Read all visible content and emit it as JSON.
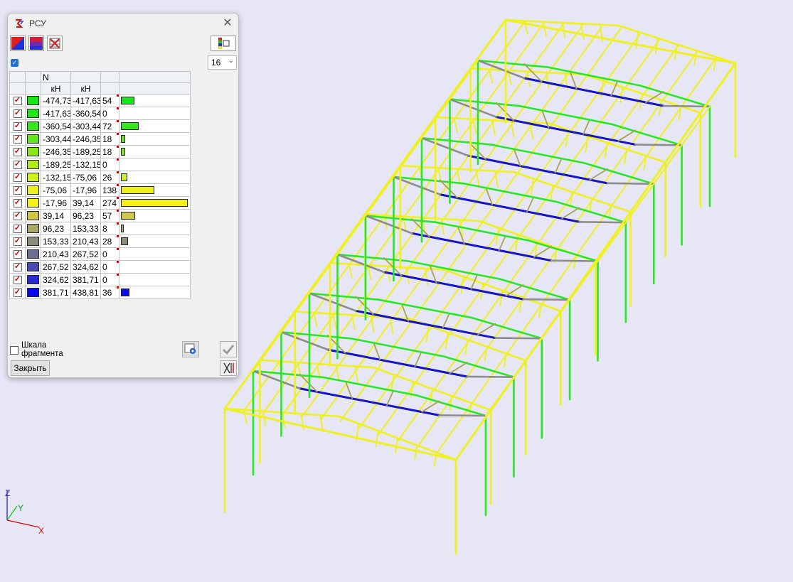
{
  "window": {
    "title": "РСУ",
    "close_symbol": "✕"
  },
  "toolbar": {
    "count_value": "16"
  },
  "table": {
    "header_top": "N",
    "header_units": [
      "кН",
      "кН"
    ],
    "max_count": 274,
    "rows": [
      {
        "from": "-474,73",
        "to": "-417,63",
        "count": "54",
        "n": 54,
        "color": "#19e619"
      },
      {
        "from": "-417,63",
        "to": "-360,54",
        "count": "0",
        "n": 0,
        "color": "#22e61c"
      },
      {
        "from": "-360,54",
        "to": "-303,44",
        "count": "72",
        "n": 72,
        "color": "#37e61c"
      },
      {
        "from": "-303,44",
        "to": "-246,35",
        "count": "18",
        "n": 18,
        "color": "#64e61c"
      },
      {
        "from": "-246,35",
        "to": "-189,25",
        "count": "18",
        "n": 18,
        "color": "#8ae61c"
      },
      {
        "from": "-189,25",
        "to": "-132,15",
        "count": "0",
        "n": 0,
        "color": "#b4ea1c"
      },
      {
        "from": "-132,15",
        "to": "-75,06",
        "count": "26",
        "n": 26,
        "color": "#d2f01c"
      },
      {
        "from": "-75,06",
        "to": "-17,96",
        "count": "138",
        "n": 138,
        "color": "#eef01c"
      },
      {
        "from": "-17,96",
        "to": "39,14",
        "count": "274",
        "n": 274,
        "color": "#f4f018"
      },
      {
        "from": "39,14",
        "to": "96,23",
        "count": "57",
        "n": 57,
        "color": "#cfc64a"
      },
      {
        "from": "96,23",
        "to": "153,33",
        "count": "8",
        "n": 8,
        "color": "#a9a66a"
      },
      {
        "from": "153,33",
        "to": "210,43",
        "count": "28",
        "n": 28,
        "color": "#8c8c78"
      },
      {
        "from": "210,43",
        "to": "267,52",
        "count": "0",
        "n": 0,
        "color": "#6c6c96"
      },
      {
        "from": "267,52",
        "to": "324,62",
        "count": "0",
        "n": 0,
        "color": "#4a4ab4"
      },
      {
        "from": "324,62",
        "to": "381,71",
        "count": "0",
        "n": 0,
        "color": "#2a2ad2"
      },
      {
        "from": "381,71",
        "to": "438,81",
        "count": "36",
        "n": 36,
        "color": "#0a0af0"
      }
    ]
  },
  "scale_checkbox": {
    "label_line1": "Шкала",
    "label_line2": "фрагмента",
    "checked": false
  },
  "buttons": {
    "close_label": "Закрыть"
  },
  "axes": {
    "z": "Z",
    "y": "Y",
    "x": "X"
  },
  "colors": {
    "background": "#e6e6f5",
    "member_yellow": "#f0f01e",
    "member_green": "#28e628",
    "member_blue": "#1414c8",
    "member_olive": "#aaa050",
    "member_gray": "#8c8c8c"
  }
}
